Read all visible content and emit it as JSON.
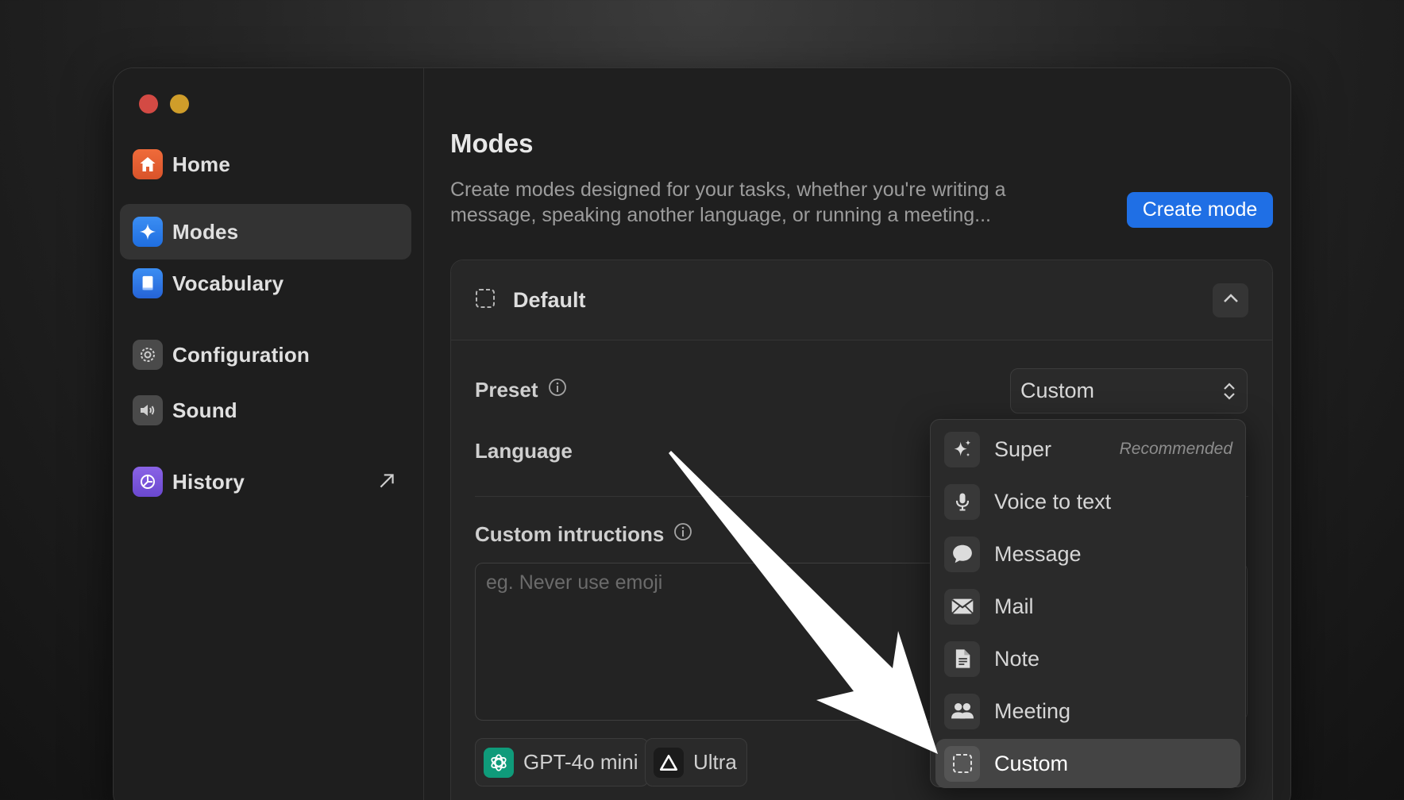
{
  "window": {
    "controls": [
      "close",
      "minimize"
    ]
  },
  "sidebar": {
    "items": [
      {
        "label": "Home",
        "icon": "home-icon"
      },
      {
        "label": "Modes",
        "icon": "sparkle-icon",
        "active": true
      },
      {
        "label": "Vocabulary",
        "icon": "book-icon"
      },
      {
        "label": "Configuration",
        "icon": "gear-icon"
      },
      {
        "label": "Sound",
        "icon": "speaker-icon"
      },
      {
        "label": "History",
        "icon": "history-icon",
        "external": true
      }
    ]
  },
  "main": {
    "title": "Modes",
    "description": "Create modes designed for your tasks, whether you're writing a message, speaking another language, or running a meeting...",
    "create_button": "Create mode",
    "card": {
      "title": "Default",
      "preset_label": "Preset",
      "preset_value": "Custom",
      "language_label": "Language",
      "instructions_label": "Custom intructions",
      "instructions_placeholder": "eg. Never use emoji",
      "chips": [
        {
          "label": "GPT-4o mini",
          "icon": "openai-icon"
        },
        {
          "label": "Ultra",
          "icon": "triangle-icon"
        }
      ]
    }
  },
  "dropdown": {
    "items": [
      {
        "label": "Super",
        "tag": "Recommended",
        "icon": "sparkles-icon"
      },
      {
        "label": "Voice to text",
        "icon": "microphone-icon"
      },
      {
        "label": "Message",
        "icon": "chat-bubble-icon"
      },
      {
        "label": "Mail",
        "icon": "envelope-icon"
      },
      {
        "label": "Note",
        "icon": "document-icon"
      },
      {
        "label": "Meeting",
        "icon": "people-icon"
      },
      {
        "label": "Custom",
        "icon": "dashed-square-icon",
        "selected": true
      }
    ]
  },
  "colors": {
    "accent": "#1f6fe5",
    "window_bg": "#1f1f1f",
    "selected_bg": "#444444"
  }
}
